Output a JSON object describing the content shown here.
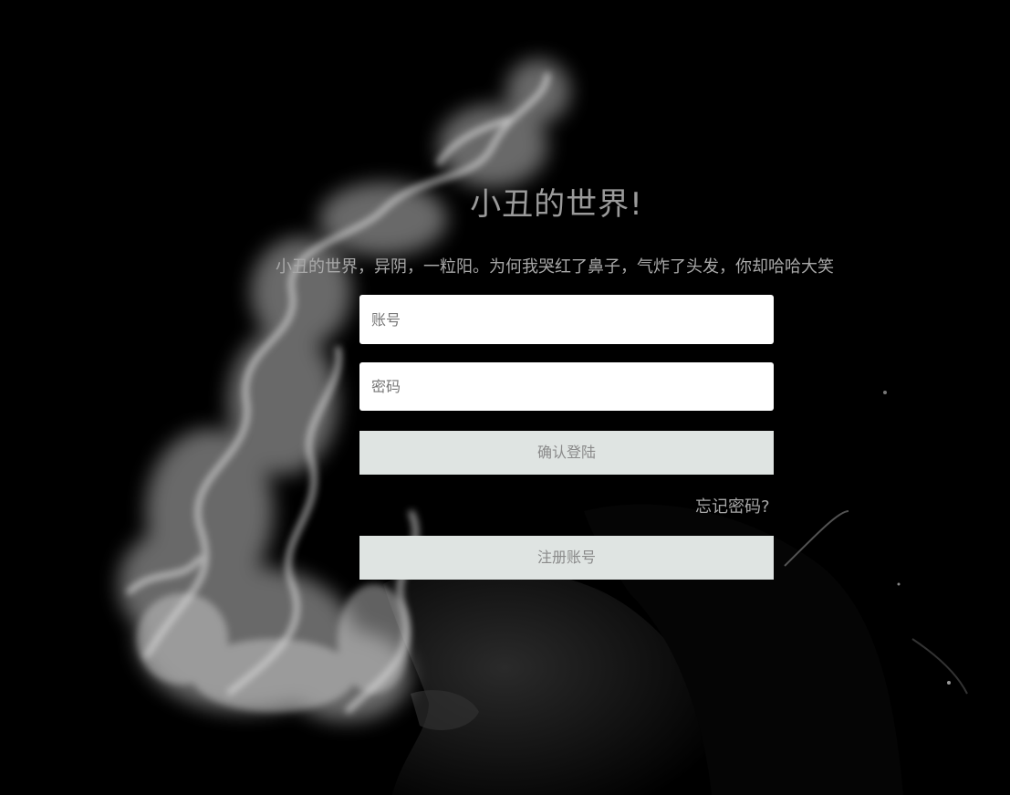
{
  "login": {
    "title": "小丑的世界!",
    "subtitle": "小丑的世界，异阴，一粒阳。为何我哭红了鼻子，气炸了头发，你却哈哈大笑",
    "username_placeholder": "账号",
    "password_placeholder": "密码",
    "login_button": "确认登陆",
    "forgot_password": "忘记密码?",
    "register_button": "注册账号"
  },
  "colors": {
    "background": "#000000",
    "button": "#dfe4e2",
    "text_muted": "#9a9a9a"
  }
}
